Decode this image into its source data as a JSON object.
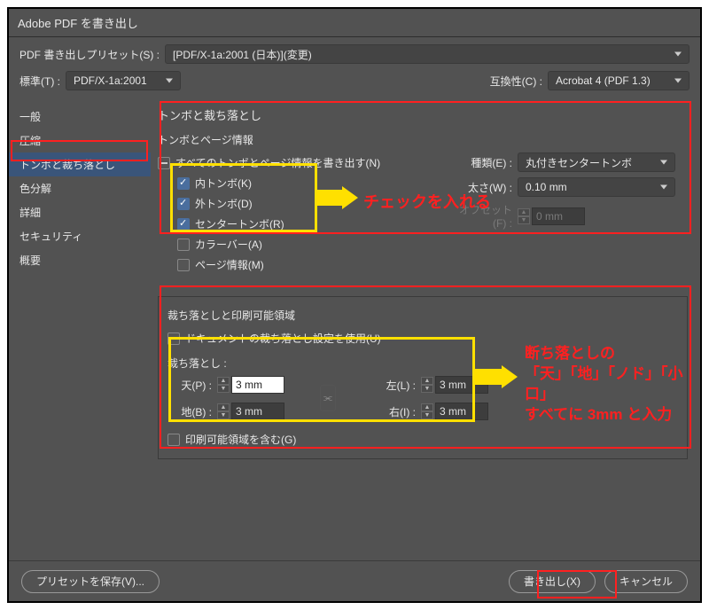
{
  "title": "Adobe PDF を書き出し",
  "preset_label": "PDF 書き出しプリセット(S) :",
  "preset_value": "[PDF/X-1a:2001 (日本)](変更)",
  "standard_label": "標準(T) :",
  "standard_value": "PDF/X-1a:2001",
  "compat_label": "互換性(C) :",
  "compat_value": "Acrobat 4 (PDF 1.3)",
  "sidebar": {
    "items": [
      {
        "label": "一般"
      },
      {
        "label": "圧縮"
      },
      {
        "label": "トンボと裁ち落とし"
      },
      {
        "label": "色分解"
      },
      {
        "label": "詳細"
      },
      {
        "label": "セキュリティ"
      },
      {
        "label": "概要"
      }
    ]
  },
  "panel_title": "トンボと裁ち落とし",
  "marks": {
    "group_title": "トンボとページ情報",
    "all_label": "すべてのトンボとページ情報を書き出す(N)",
    "inner_label": "内トンボ(K)",
    "outer_label": "外トンボ(D)",
    "center_label": "センタートンボ(R)",
    "colorbar_label": "カラーバー(A)",
    "pageinfo_label": "ページ情報(M)",
    "type_label": "種類(E) :",
    "type_value": "丸付きセンタートンボ",
    "weight_label": "太さ(W) :",
    "weight_value": "0.10 mm",
    "offset_label": "オフセット(F) :",
    "offset_value": "0 mm"
  },
  "bleed": {
    "group_title": "裁ち落としと印刷可能領域",
    "usedoc_label": "ドキュメントの裁ち落とし設定を使用(U)",
    "section_label": "裁ち落とし :",
    "top_label": "天(P) :",
    "top_value": "3 mm",
    "bottom_label": "地(B) :",
    "bottom_value": "3 mm",
    "left_label": "左(L) :",
    "left_value": "3 mm",
    "right_label": "右(I) :",
    "right_value": "3 mm",
    "slug_label": "印刷可能領域を含む(G)"
  },
  "footer": {
    "save_preset": "プリセットを保存(V)...",
    "export": "書き出し(X)",
    "cancel": "キャンセル"
  },
  "annotations": {
    "check_text": "チェックを入れる",
    "bleed_text_l1": "断ち落としの",
    "bleed_text_l2": "「天」「地」「ノド」「小口」",
    "bleed_text_l3": "すべてに 3mm と入力"
  }
}
